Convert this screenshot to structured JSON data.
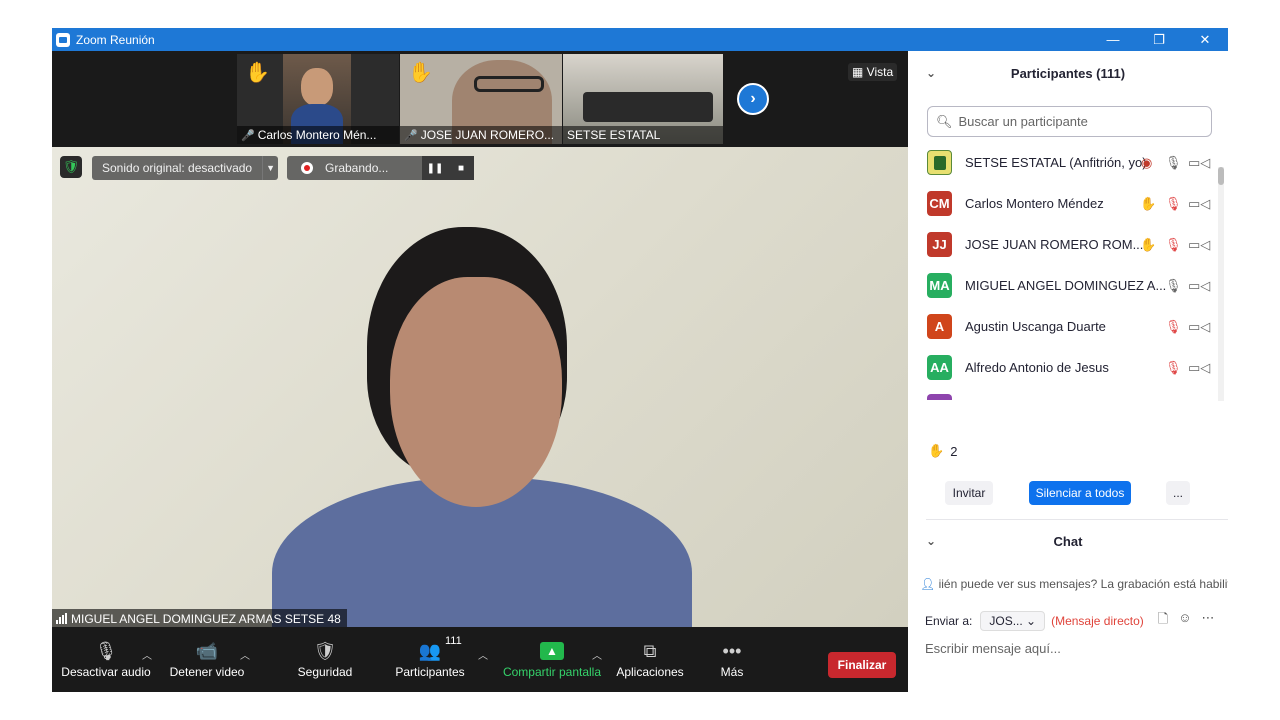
{
  "window": {
    "title": "Zoom Reunión",
    "controls": [
      "—",
      "❐",
      "✕"
    ]
  },
  "thumbnails": [
    {
      "name": "Carlos Montero  Mén...",
      "hand": "✋",
      "muted": true
    },
    {
      "name": "JOSE JUAN ROMERO...",
      "hand": "✋",
      "muted": true
    },
    {
      "name": "SETSE ESTATAL",
      "hand": "",
      "muted": false
    }
  ],
  "view_label": "Vista",
  "main": {
    "sound_status": "Sonido original: desactivado",
    "recording_label": "Grabando...",
    "speaker_name": "MIGUEL ANGEL DOMINGUEZ ARMAS  SETSE 48"
  },
  "toolbar": {
    "mute": "Desactivar audio",
    "video": "Detener video",
    "security": "Seguridad",
    "participants": "Participantes",
    "participants_count": "111",
    "share": "Compartir pantalla",
    "apps": "Aplicaciones",
    "more": "Más",
    "end": "Finalizar"
  },
  "participants_panel": {
    "title": "Participantes (111)",
    "search_placeholder": "Buscar un participante",
    "items": [
      {
        "initials": "",
        "name": "SETSE ESTATAL (Anfitrión, yo)",
        "color": "#e8e070",
        "hand": false,
        "mic": "on",
        "recording": true
      },
      {
        "initials": "CM",
        "name": "Carlos Montero  Méndez",
        "color": "#c0392b",
        "hand": true,
        "mic": "muted",
        "recording": false
      },
      {
        "initials": "JJ",
        "name": "JOSE JUAN ROMERO ROM...",
        "color": "#c0392b",
        "hand": true,
        "mic": "muted",
        "recording": false
      },
      {
        "initials": "MA",
        "name": "MIGUEL ANGEL DOMINGUEZ A...",
        "color": "#27ae60",
        "hand": false,
        "mic": "on",
        "recording": false
      },
      {
        "initials": "A",
        "name": "Agustin Uscanga Duarte",
        "color": "#d0451b",
        "hand": false,
        "mic": "muted",
        "recording": false
      },
      {
        "initials": "AA",
        "name": "Alfredo Antonio de Jesus",
        "color": "#27ae60",
        "hand": false,
        "mic": "muted",
        "recording": false
      }
    ],
    "raised_hands": "2",
    "invite": "Invitar",
    "mute_all": "Silenciar a todos",
    "more": "..."
  },
  "chat": {
    "title": "Chat",
    "notice": "iién puede ver sus mensajes? La grabación está habilit",
    "send_to_label": "Enviar a:",
    "recipient": "JOS...",
    "direct": "(Mensaje directo)",
    "input_placeholder": "Escribir mensaje aquí..."
  }
}
